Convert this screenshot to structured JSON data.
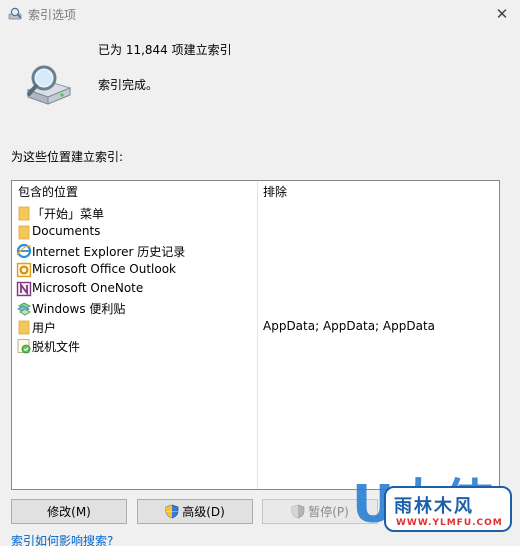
{
  "window": {
    "title": "索引选项",
    "close_glyph": "✕"
  },
  "status": {
    "count_text": "已为 11,844 项建立索引",
    "message": "索引完成。",
    "icon": "magnifier-drive-icon"
  },
  "locations_label": "为这些位置建立索引:",
  "list": {
    "columns": {
      "location": "包含的位置",
      "exclude": "排除"
    },
    "rows": [
      {
        "icon": "folder-icon",
        "location": "「开始」菜单",
        "exclude": ""
      },
      {
        "icon": "folder-icon",
        "location": "Documents",
        "exclude": ""
      },
      {
        "icon": "ie-icon",
        "location": "Internet Explorer 历史记录",
        "exclude": ""
      },
      {
        "icon": "outlook-icon",
        "location": "Microsoft Office Outlook",
        "exclude": ""
      },
      {
        "icon": "onenote-icon",
        "location": "Microsoft OneNote",
        "exclude": ""
      },
      {
        "icon": "sticky-notes-icon",
        "location": "Windows 便利贴",
        "exclude": ""
      },
      {
        "icon": "folder-icon",
        "location": "用户",
        "exclude": "AppData; AppData; AppData"
      },
      {
        "icon": "offline-files-icon",
        "location": "脱机文件",
        "exclude": ""
      }
    ]
  },
  "buttons": {
    "modify": "修改(M)",
    "advanced": "高级(D)",
    "pause": "暂停(P)"
  },
  "help_link": "索引如何影响搜索?",
  "watermark": {
    "big": "U大侠",
    "name": "雨林木风",
    "url": "WWW.YLMFU.COM"
  },
  "colors": {
    "link": "#0066cc",
    "folder": "#f5c85c",
    "accent": "#1d5faa"
  }
}
